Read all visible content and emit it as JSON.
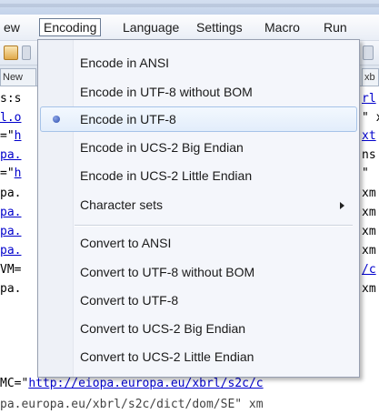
{
  "menubar": {
    "items": [
      {
        "label": "ew"
      },
      {
        "label": "Encoding"
      },
      {
        "label": "Language"
      },
      {
        "label": "Settings"
      },
      {
        "label": "Macro"
      },
      {
        "label": "Run"
      }
    ]
  },
  "tabs": [
    {
      "label": "New"
    },
    {
      "label": "xb"
    }
  ],
  "editor": {
    "lines": [
      {
        "pre": "s:s",
        "link": "",
        "post": ""
      },
      {
        "pre": "",
        "link": "l.o",
        "post": ""
      },
      {
        "pre": "=\"",
        "link": "h",
        "post": ""
      },
      {
        "pre": "",
        "link": "pa.",
        "post": ""
      },
      {
        "pre": "=\"",
        "link": "h",
        "post": ""
      },
      {
        "pre": "pa.",
        "link": "",
        "post": ""
      },
      {
        "pre": "",
        "link": "pa.",
        "post": ""
      },
      {
        "pre": "",
        "link": "pa.",
        "post": ""
      },
      {
        "pre": "",
        "link": "pa.",
        "post": ""
      },
      {
        "pre": "VM=",
        "link": "",
        "post": ""
      },
      {
        "pre": "pa.",
        "link": "",
        "post": ""
      }
    ],
    "right_fragments": [
      {
        "text": "rl",
        "link": true
      },
      {
        "text": "\" x",
        "link": false
      },
      {
        "text": "xt",
        "link": true
      },
      {
        "text": "ns",
        "link": false
      },
      {
        "text": "\"",
        "link": false
      },
      {
        "text": "xm",
        "link": false
      },
      {
        "text": "xm",
        "link": false
      },
      {
        "text": "xm",
        "link": false
      },
      {
        "text": "xm",
        "link": false
      },
      {
        "text": "/c",
        "link": true
      },
      {
        "text": "xm",
        "link": false
      }
    ],
    "bottom_line": {
      "pre": "MC=\"",
      "link": "http://eiopa.europa.eu/xbrl/s2c/c",
      "post": ""
    },
    "cut_line": "pa.europa.eu/xbrl/s2c/dict/dom/SE\" xm"
  },
  "encoding_menu": {
    "items": [
      {
        "label": "Encode in ANSI",
        "checked": false
      },
      {
        "label": "Encode in UTF-8 without BOM",
        "checked": false
      },
      {
        "label": "Encode in UTF-8",
        "checked": true
      },
      {
        "label": "Encode in UCS-2 Big Endian",
        "checked": false
      },
      {
        "label": "Encode in UCS-2 Little Endian",
        "checked": false
      },
      {
        "label": "Character sets",
        "checked": false,
        "submenu": true
      },
      {
        "label": "Convert to ANSI",
        "checked": false
      },
      {
        "label": "Convert to UTF-8 without BOM",
        "checked": false
      },
      {
        "label": "Convert to UTF-8",
        "checked": false
      },
      {
        "label": "Convert to UCS-2 Big Endian",
        "checked": false
      },
      {
        "label": "Convert to UCS-2 Little Endian",
        "checked": false
      }
    ]
  },
  "icons": {
    "toolbar": [
      "new-file-icon",
      "open-file-icon"
    ],
    "checked": "radio-bullet-icon",
    "submenu": "submenu-arrow-icon"
  },
  "colors": {
    "selection_bg": "#e2edfb",
    "selection_border": "#a6c3e8",
    "link": "#0000cc",
    "menu_bg": "#f4f6fb"
  }
}
